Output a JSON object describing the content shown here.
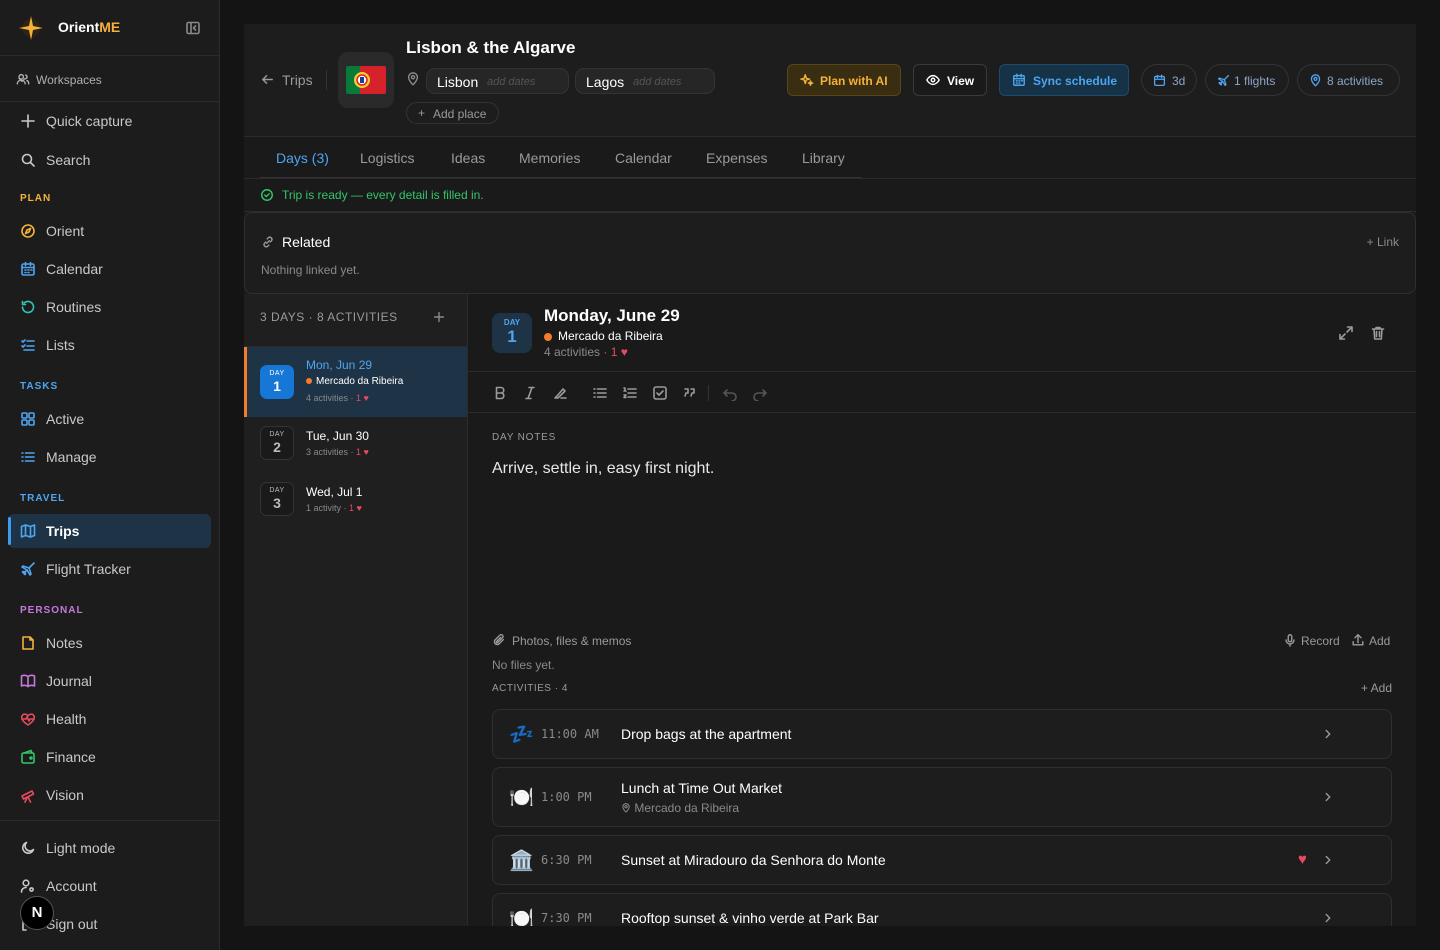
{
  "brand": {
    "name_prefix": "Orient",
    "name_suffix": "ME"
  },
  "sidebar": {
    "workspaces": "Workspaces",
    "quick_capture": "Quick capture",
    "search": "Search",
    "sections": {
      "plan": "PLAN",
      "tasks": "TASKS",
      "travel": "TRAVEL",
      "personal": "PERSONAL"
    },
    "items": {
      "orient": "Orient",
      "calendar": "Calendar",
      "routines": "Routines",
      "lists": "Lists",
      "active": "Active",
      "manage": "Manage",
      "trips": "Trips",
      "flight_tracker": "Flight Tracker",
      "notes": "Notes",
      "journal": "Journal",
      "health": "Health",
      "finance": "Finance",
      "vision": "Vision"
    },
    "light_mode": "Light mode",
    "account": "Account",
    "sign_out": "Sign out",
    "avatar": "N"
  },
  "header": {
    "back": "Trips",
    "title": "Lisbon & the Algarve",
    "flag": "🇵🇹",
    "places": [
      {
        "name": "Lisbon",
        "dates": "add dates"
      },
      {
        "name": "Lagos",
        "dates": "add dates"
      }
    ],
    "add_place": "Add place",
    "plan_ai": "Plan with AI",
    "view": "View",
    "sync": "Sync schedule",
    "chips": {
      "days": "3d",
      "flights": "1 flights",
      "activities": "8 activities"
    }
  },
  "tabs": [
    "Days (3)",
    "Logistics",
    "Ideas",
    "Memories",
    "Calendar",
    "Expenses",
    "Library"
  ],
  "ready": "Trip is ready — every detail is filled in.",
  "related": {
    "title": "Related",
    "empty": "Nothing linked yet.",
    "link": "+ Link"
  },
  "days_panel": {
    "header": "3 DAYS · 8 ACTIVITIES",
    "days": [
      {
        "label": "DAY",
        "num": "1",
        "date": "Mon, Jun 29",
        "place": "Mercado da Ribeira",
        "meta": "4 activities · ",
        "count": "1",
        "heart": "♥"
      },
      {
        "label": "DAY",
        "num": "2",
        "date": "Tue, Jun 30",
        "meta": "3 activities · ",
        "count": "1",
        "heart": "♥"
      },
      {
        "label": "DAY",
        "num": "3",
        "date": "Wed, Jul 1",
        "meta": "1 activity · ",
        "count": "1",
        "heart": "♥"
      }
    ]
  },
  "day": {
    "badge_label": "DAY",
    "badge_num": "1",
    "title": "Monday, June 29",
    "location": "Mercado da Ribeira",
    "sub": "4 activities",
    "sub_count": "· 1 ♥",
    "notes_label": "DAY NOTES",
    "notes": "Arrive, settle in, easy first night.",
    "files_label": "Photos, files & memos",
    "record": "Record",
    "add": "Add",
    "no_files": "No files yet.",
    "activities_label": "ACTIVITIES · 4",
    "activities_add": "+ Add",
    "activities": [
      {
        "emoji": "💤",
        "time": "11:00 AM",
        "title": "Drop bags at the apartment",
        "location": "",
        "favorite": false
      },
      {
        "emoji": "🍽️",
        "time": "1:00 PM",
        "title": "Lunch at Time Out Market",
        "location": "Mercado da Ribeira",
        "favorite": false
      },
      {
        "emoji": "🏛️",
        "time": "6:30 PM",
        "title": "Sunset at Miradouro da Senhora do Monte",
        "location": "",
        "favorite": true
      },
      {
        "emoji": "🍽️",
        "time": "7:30 PM",
        "title": "Rooftop sunset & vinho verde at Park Bar",
        "location": "",
        "favorite": false
      }
    ]
  },
  "colors": {
    "accent": "#4ea5f0",
    "orange": "#f57c2a",
    "gold": "#f5b13a",
    "green": "#34c46b",
    "red": "#e84a5f"
  }
}
